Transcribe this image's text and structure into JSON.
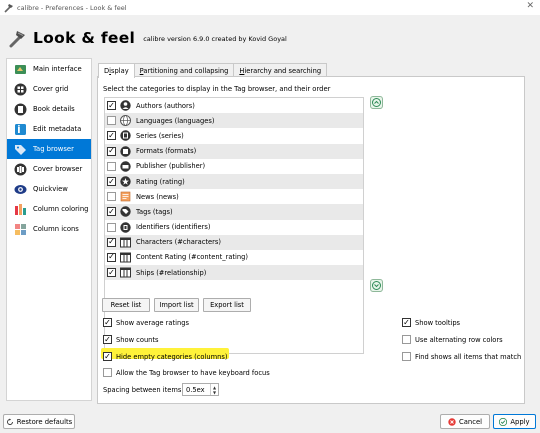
{
  "window": {
    "title": "calibre - Preferences - Look & feel",
    "close_icon": "close-icon"
  },
  "header": {
    "title": "Look & feel",
    "subtitle": "calibre version 6.9.0 created by Kovid Goyal"
  },
  "sidebar": {
    "items": [
      {
        "label": "Main interface",
        "icon": "main-interface-icon",
        "selected": false
      },
      {
        "label": "Cover grid",
        "icon": "cover-grid-icon",
        "selected": false
      },
      {
        "label": "Book details",
        "icon": "book-details-icon",
        "selected": false
      },
      {
        "label": "Edit metadata",
        "icon": "edit-metadata-icon",
        "selected": false
      },
      {
        "label": "Tag browser",
        "icon": "tag-browser-icon",
        "selected": true
      },
      {
        "label": "Cover browser",
        "icon": "cover-browser-icon",
        "selected": false
      },
      {
        "label": "Quickview",
        "icon": "quickview-icon",
        "selected": false
      },
      {
        "label": "Column coloring",
        "icon": "column-coloring-icon",
        "selected": false
      },
      {
        "label": "Column icons",
        "icon": "column-icons-icon",
        "selected": false
      }
    ]
  },
  "tabs": [
    {
      "label": "Display",
      "accel": "i",
      "active": true
    },
    {
      "label": "Partitioning and collapsing",
      "accel": "P",
      "active": false
    },
    {
      "label": "Hierarchy and searching",
      "accel": "H",
      "active": false
    }
  ],
  "display": {
    "instruction": "Select the categories to display in the Tag browser, and their order",
    "categories": [
      {
        "label": "Authors (authors)",
        "checked": true,
        "icon": "authors-icon"
      },
      {
        "label": "Languages (languages)",
        "checked": false,
        "icon": "languages-icon"
      },
      {
        "label": "Series (series)",
        "checked": true,
        "icon": "series-icon"
      },
      {
        "label": "Formats (formats)",
        "checked": true,
        "icon": "formats-icon"
      },
      {
        "label": "Publisher (publisher)",
        "checked": false,
        "icon": "publisher-icon"
      },
      {
        "label": "Rating (rating)",
        "checked": true,
        "icon": "rating-icon"
      },
      {
        "label": "News (news)",
        "checked": false,
        "icon": "news-icon"
      },
      {
        "label": "Tags (tags)",
        "checked": true,
        "icon": "tags-icon"
      },
      {
        "label": "Identifiers (identifiers)",
        "checked": false,
        "icon": "identifiers-icon"
      },
      {
        "label": "Characters (#characters)",
        "checked": true,
        "icon": "column-icon"
      },
      {
        "label": "Content Rating (#content_rating)",
        "checked": true,
        "icon": "column-icon"
      },
      {
        "label": "Ships (#relationship)",
        "checked": true,
        "icon": "column-icon"
      }
    ],
    "buttons": {
      "reset": "Reset list",
      "import": "Import list",
      "export": "Export list"
    },
    "options": {
      "show_average_ratings": {
        "label": "Show average ratings",
        "checked": true
      },
      "show_counts": {
        "label": "Show counts",
        "checked": true
      },
      "hide_empty": {
        "label": "Hide empty categories (columns)",
        "checked": true
      },
      "keyboard_focus": {
        "label": "Allow the Tag browser to have keyboard focus",
        "checked": false
      },
      "show_tooltips": {
        "label": "Show tooltips",
        "checked": true
      },
      "alternating_rows": {
        "label": "Use alternating row colors",
        "checked": false
      },
      "find_all": {
        "label": "Find shows all items that match",
        "checked": false
      }
    },
    "spacing": {
      "label": "Spacing between items:",
      "value": "0.5ex"
    }
  },
  "footer": {
    "restore": "Restore defaults",
    "cancel": "Cancel",
    "apply": "Apply"
  },
  "colors": {
    "accent": "#0078d7",
    "highlight": "#fff23a",
    "alt_row": "#e9e9e9"
  }
}
